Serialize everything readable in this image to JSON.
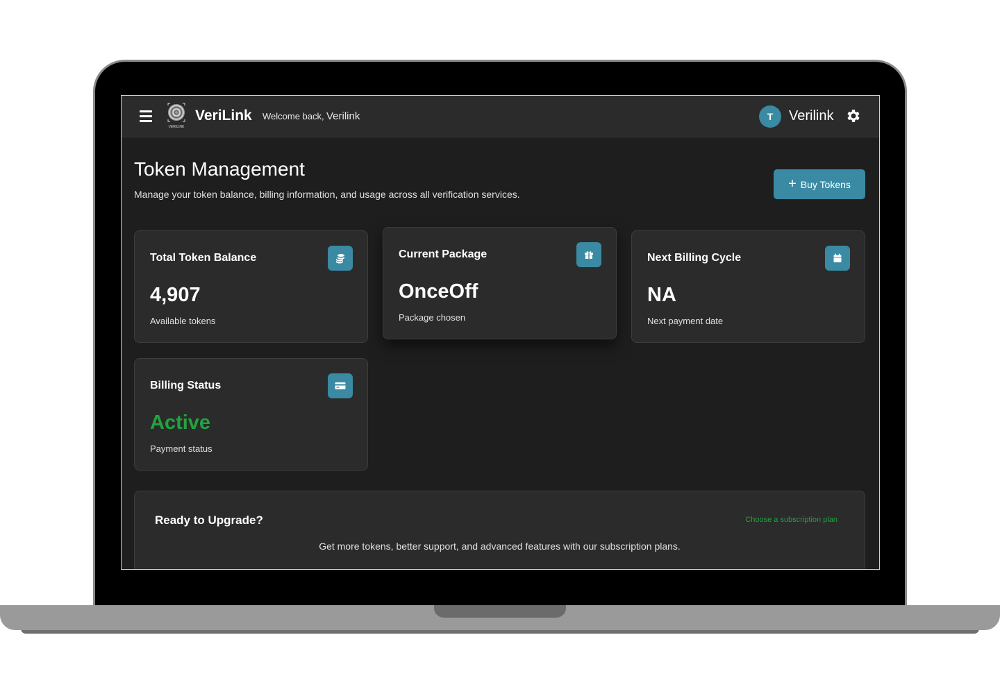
{
  "header": {
    "brand": "VeriLink",
    "logo_text": "VERILINK",
    "welcome": "Welcome back,",
    "welcome_name": "Verilink",
    "avatar_initial": "T",
    "user_name": "Verilink"
  },
  "page": {
    "title": "Token Management",
    "subtitle": "Manage your token balance, billing information, and usage across all verification services.",
    "buy_button": "Buy Tokens"
  },
  "cards": [
    {
      "title": "Total Token Balance",
      "value": "4,907",
      "caption": "Available tokens",
      "icon": "coins-icon"
    },
    {
      "title": "Current Package",
      "value": "OnceOff",
      "caption": "Package chosen",
      "icon": "gift-icon"
    },
    {
      "title": "Next Billing Cycle",
      "value": "NA",
      "caption": "Next payment date",
      "icon": "calendar-icon"
    },
    {
      "title": "Billing Status",
      "value": "Active",
      "caption": "Payment status",
      "icon": "credit-card-icon"
    }
  ],
  "upgrade": {
    "title": "Ready to Upgrade?",
    "link": "Choose a subscription plan",
    "description": "Get more tokens, better support, and advanced features with our subscription plans."
  },
  "colors": {
    "accent": "#3a8aa3",
    "success": "#22a33f",
    "background": "#1e1e1e",
    "card": "#2b2b2b"
  }
}
